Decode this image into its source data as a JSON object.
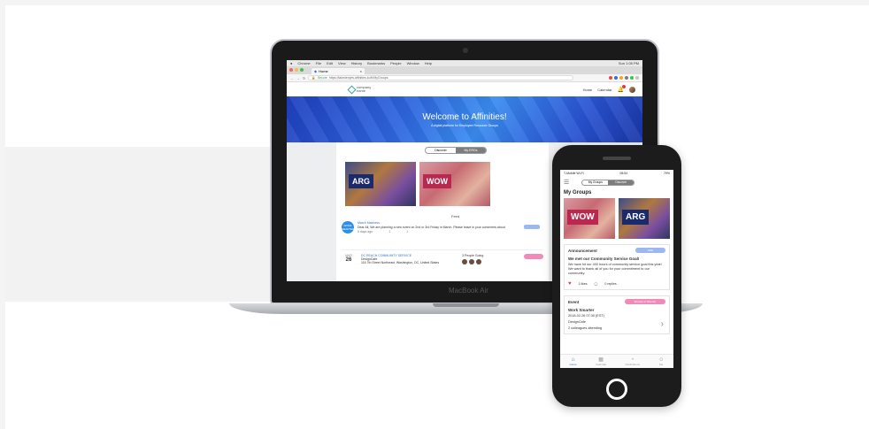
{
  "laptop": {
    "brand": "MacBook Air",
    "menubar": [
      "Chrome",
      "File",
      "Edit",
      "View",
      "History",
      "Bookmarks",
      "People",
      "Window",
      "Help"
    ],
    "menubar_right": "Sun 1:05 PM",
    "tab_label": "Home",
    "url": "https://takedevyes.affinities.io/#!/MyGroups",
    "secure_label": "Secure",
    "site": {
      "logo_line1": "company",
      "logo_line2": "name",
      "nav_home": "Home",
      "nav_calendar": "Calendar",
      "hero_title": "Welcome to Affinities!",
      "hero_subtitle": "A digital platform for Employee Resource Groups",
      "toggle_discover": "Discover",
      "toggle_mygroups": "My ERGs",
      "tile_arg": "ARG",
      "tile_wow": "WOW",
      "feed_label": "Feed",
      "post_logo": "WORK SMARTER",
      "post_title": "March Madness",
      "post_text": "Dear All, We are planning a new event on 2nd or 3rd Friday in March. Please leave in your comments about",
      "post_time": "5 days ago",
      "post_likes": "1",
      "post_comments": "1",
      "event_month": "MAR",
      "event_day": "26",
      "event_title": "DC REACH COMMUNITY SERVICE",
      "event_org": "DesignCafe",
      "event_address": "116 7th Street Northeast, Washington, DC, United States",
      "event_attendees": "3 People Going"
    }
  },
  "phone": {
    "status_left": "T-Mobile Wi-Fi",
    "status_time": "08:54",
    "status_right": "79%",
    "toggle_mygroups": "My Groups",
    "toggle_discover": "Discover",
    "section_title": "My Groups",
    "tile_wow": "WOW",
    "tile_arg": "ARG",
    "announcement": {
      "label": "Announcement",
      "pill": "ARG",
      "headline": "We met our Community Service Goal!",
      "text": "We have hit our 400 hours of community service goal this year! We want to thank all of you for your commitment to our community.",
      "likes": "1 likes",
      "replies": "0 replies"
    },
    "event": {
      "label": "Event",
      "pill": "Women of Wonder",
      "title": "Work Smarter",
      "datetime": "2018-02-26 07:30 (EST)",
      "org": "DesignCafe",
      "attending": "2 colleagues attending"
    },
    "tabs": [
      "Home",
      "Calendar",
      "Notifications",
      "Me"
    ]
  }
}
